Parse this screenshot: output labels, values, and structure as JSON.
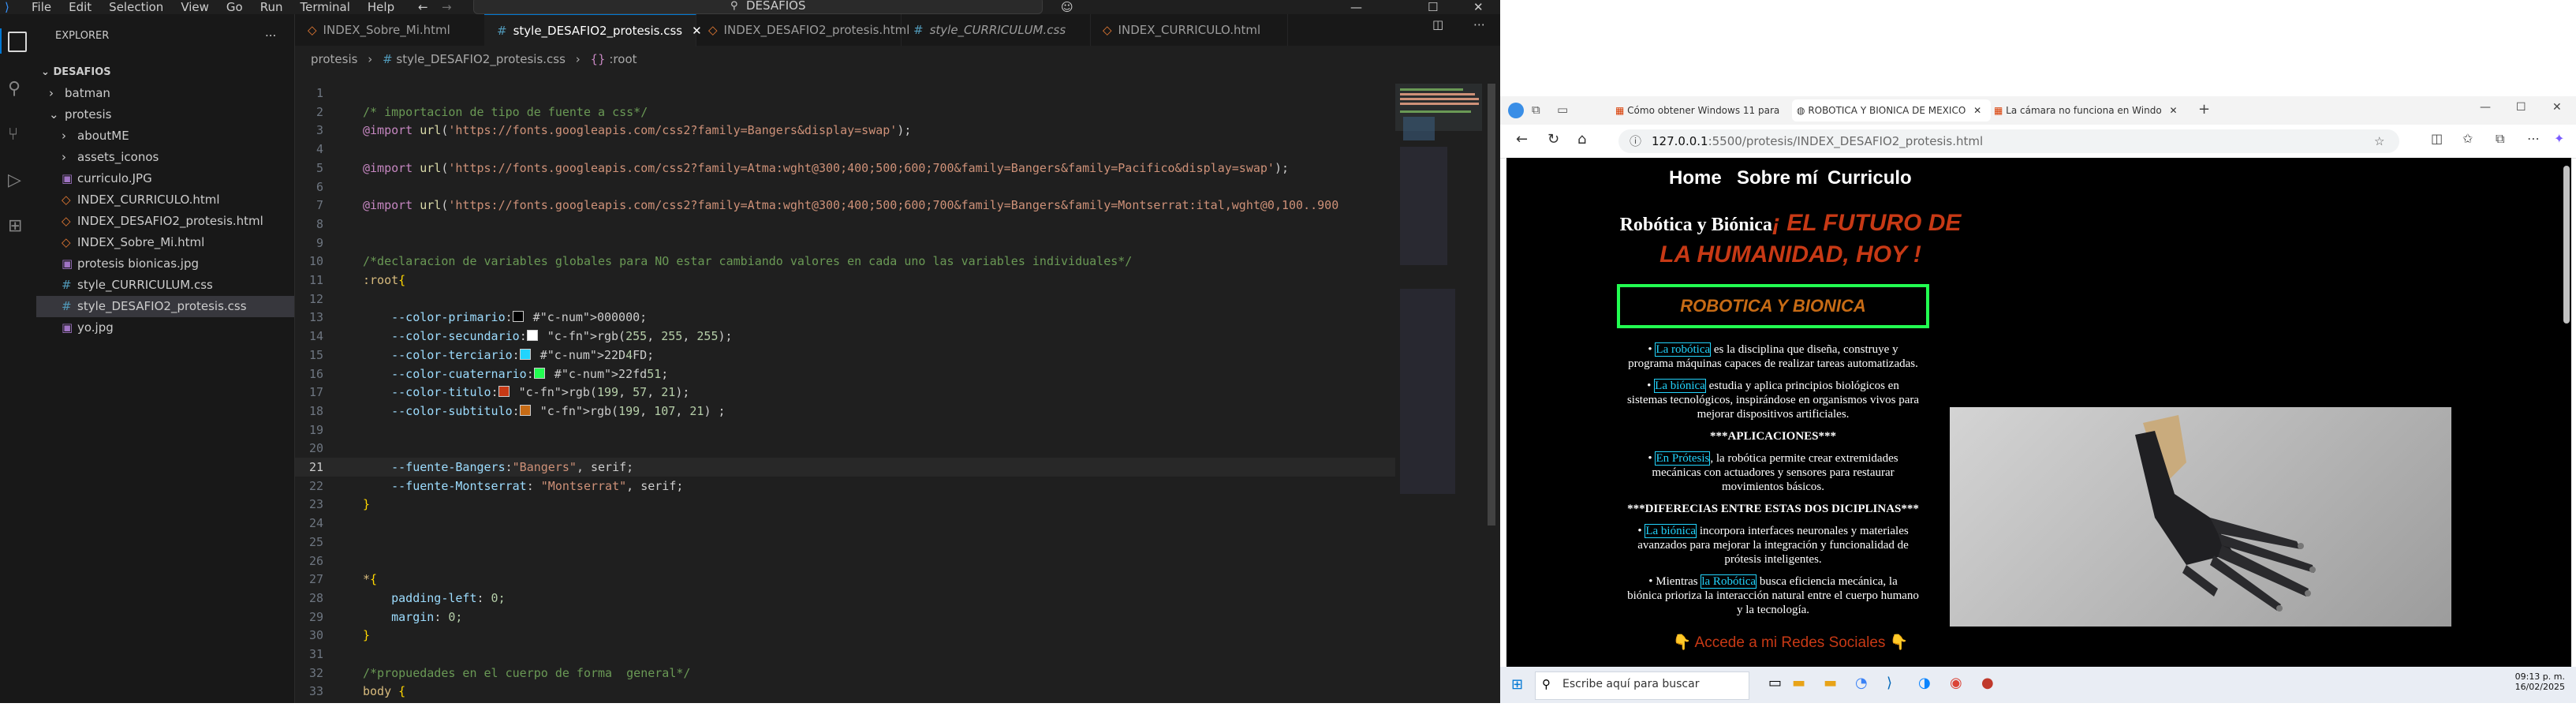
{
  "vscode": {
    "menu": [
      "File",
      "Edit",
      "Selection",
      "View",
      "Go",
      "Run",
      "Terminal",
      "Help"
    ],
    "search": "DESAFIOS",
    "explorer_title": "EXPLORER",
    "explorer_more": "...",
    "root_folder": "DESAFIOS",
    "tree": [
      {
        "label": "batman",
        "kind": "folder-closed",
        "indent": 1
      },
      {
        "label": "protesis",
        "kind": "folder-open",
        "indent": 1
      },
      {
        "label": "aboutME",
        "kind": "folder-closed",
        "indent": 2
      },
      {
        "label": "assets_iconos",
        "kind": "folder-closed",
        "indent": 2
      },
      {
        "label": "curriculo.JPG",
        "kind": "image",
        "indent": 2
      },
      {
        "label": "INDEX_CURRICULO.html",
        "kind": "html",
        "indent": 2
      },
      {
        "label": "INDEX_DESAFIO2_protesis.html",
        "kind": "html",
        "indent": 2
      },
      {
        "label": "INDEX_Sobre_Mi.html",
        "kind": "html",
        "indent": 2
      },
      {
        "label": "protesis bionicas.jpg",
        "kind": "image",
        "indent": 2
      },
      {
        "label": "style_CURRICULUM.css",
        "kind": "css",
        "indent": 2
      },
      {
        "label": "style_DESAFIO2_protesis.css",
        "kind": "css",
        "indent": 2,
        "selected": true
      },
      {
        "label": "yo.jpg",
        "kind": "image",
        "indent": 2
      }
    ],
    "tabs": [
      {
        "label": "INDEX_Sobre_Mi.html",
        "kind": "html"
      },
      {
        "label": "style_DESAFIO2_protesis.css",
        "kind": "css",
        "active": true
      },
      {
        "label": "INDEX_DESAFIO2_protesis.html",
        "kind": "html"
      },
      {
        "label": "style_CURRICULUM.css",
        "kind": "css"
      },
      {
        "label": "INDEX_CURRICULO.html",
        "kind": "html"
      }
    ],
    "breadcrumb": [
      "protesis",
      "style_DESAFIO2_protesis.css",
      ":root"
    ],
    "code_lines": [
      {
        "n": "1",
        "t": ""
      },
      {
        "n": "2",
        "t": "/* importacion de tipo de fuente a css*/"
      },
      {
        "n": "3",
        "t": "@import url('https://fonts.googleapis.com/css2?family=Bangers&display=swap');"
      },
      {
        "n": "4",
        "t": ""
      },
      {
        "n": "5",
        "t": "@import url('https://fonts.googleapis.com/css2?family=Atma:wght@300;400;500;600;700&family=Bangers&family=Pacifico&display=swap');"
      },
      {
        "n": "6",
        "t": ""
      },
      {
        "n": "7",
        "t": "@import url('https://fonts.googleapis.com/css2?family=Atma:wght@300;400;500;600;700&family=Bangers&family=Montserrat:ital,wght@0,100..900"
      },
      {
        "n": "8",
        "t": ""
      },
      {
        "n": "9",
        "t": ""
      },
      {
        "n": "10",
        "t": "/*declaracion de variables globales para NO estar cambiando valores en cada uno las variables individuales*/"
      },
      {
        "n": "11",
        "t": ":root{"
      },
      {
        "n": "12",
        "t": ""
      },
      {
        "n": "13",
        "t": "    --color-primario: #000000;"
      },
      {
        "n": "14",
        "t": "    --color-secundario: rgb(255, 255, 255);"
      },
      {
        "n": "15",
        "t": "    --color-terciario: #22D4FD;"
      },
      {
        "n": "16",
        "t": "    --color-cuaternario: #22fd51;"
      },
      {
        "n": "17",
        "t": "    --color-titulo: rgb(199, 57, 21);"
      },
      {
        "n": "18",
        "t": "    --color-subtitulo: rgb(199, 107, 21) ;"
      },
      {
        "n": "19",
        "t": ""
      },
      {
        "n": "20",
        "t": ""
      },
      {
        "n": "21",
        "t": "    --fuente-Bangers:\"Bangers\", serif;"
      },
      {
        "n": "22",
        "t": "    --fuente-Montserrat: \"Montserrat\", serif;"
      },
      {
        "n": "23",
        "t": "}"
      },
      {
        "n": "24",
        "t": ""
      },
      {
        "n": "25",
        "t": ""
      },
      {
        "n": "26",
        "t": ""
      },
      {
        "n": "27",
        "t": "*{"
      },
      {
        "n": "28",
        "t": "    padding-left: 0;"
      },
      {
        "n": "29",
        "t": "    margin: 0;"
      },
      {
        "n": "30",
        "t": "}"
      },
      {
        "n": "31",
        "t": ""
      },
      {
        "n": "32",
        "t": "/*propuedades en el cuerpo de forma  general*/"
      },
      {
        "n": "33",
        "t": "body {"
      }
    ],
    "current_line": "21",
    "swatch_colors": {
      "13": "#000000",
      "14": "#ffffff",
      "15": "#22d4fd",
      "16": "#22fd51",
      "17": "#c73915",
      "18": "#c76b15"
    }
  },
  "browser": {
    "tabs": [
      "Cómo obtener Windows 11 para",
      "ROBOTICA Y BIONICA DE MEXICO",
      "La cámara no funciona en Windo"
    ],
    "url_host": "127.0.0.1",
    "url_rest": ":5500/protesis/INDEX_DESAFIO2_protesis.html",
    "page": {
      "nav": [
        "Home",
        "Sobre mí",
        "Curriculo"
      ],
      "title_plain": "Robótica y Biónica",
      "title_emph_1": "¡ EL FUTURO DE",
      "title_emph_2": "LA HUMANIDAD, HOY !",
      "banner": "ROBOTICA Y BIONICA",
      "b1_link": "La robótica",
      "b1_text_1": "es la disciplina que diseña, construye y",
      "b1_text_2": "programa máquinas capaces de realizar tareas automatizadas.",
      "b2_link": "La biónica",
      "b2_text_1": "estudia y aplica principios biológicos en",
      "b2_text_2": "sistemas tecnológicos, inspirándose en organismos vivos para",
      "b2_text_3": "mejorar dispositivos artificiales.",
      "h_apps": "***APLICACIONES***",
      "b3_link": "En Prótesis",
      "b3_text_1": ", la robótica permite crear extremidades",
      "b3_text_2": "mecánicas con actuadores y sensores para restaurar",
      "b3_text_3": "movimientos básicos.",
      "h_diff": "***DIFERECIAS ENTRE ESTAS DOS DICIPLINAS***",
      "b4_link": "La biónica",
      "b4_text_1": "incorpora interfaces neuronales y materiales",
      "b4_text_2": "avanzados para mejorar la integración y funcionalidad de",
      "b4_text_3": "prótesis inteligentes.",
      "b5_pre": "Mientras",
      "b5_link": "la Robótica",
      "b5_text_1": "busca eficiencia mecánica, la",
      "b5_text_2": "biónica prioriza la interacción natural entre el cuerpo humano",
      "b5_text_3": "y la tecnología.",
      "social": "👇 Accede a mi Redes Sociales 👇"
    },
    "taskbar": {
      "search": "Escribe aquí para buscar",
      "time": "09:13 p. m.",
      "date": "16/02/2025"
    },
    "colors": {
      "bg": "#000000",
      "accent": "#22d4fd",
      "green": "#22fd51",
      "title": "#c73915",
      "subtitle": "#c76b15"
    }
  }
}
